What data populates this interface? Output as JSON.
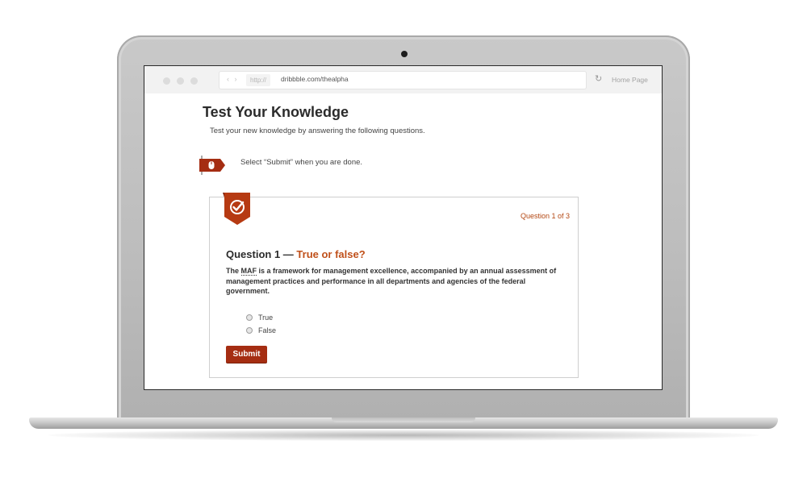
{
  "browser": {
    "protocol": "http://",
    "url": "dribbble.com/thealpha",
    "nav_arrows": "‹ ›",
    "refresh_icon": "refresh-icon",
    "home_link": "Home Page"
  },
  "page": {
    "title": "Test Your Knowledge",
    "subtitle": "Test your new knowledge by answering the following questions.",
    "instruction": "Select “Submit” when you are done.",
    "instruction_icon": "mouse-icon"
  },
  "quiz": {
    "badge_icon": "checkmark-badge-icon",
    "counter": "Question 1 of 3",
    "heading_prefix": "Question 1 — ",
    "heading_type": "True or false?",
    "text_prefix": "The ",
    "text_abbr": "MAF",
    "text_rest": " is a framework for management excellence, accompanied by an annual assessment of management practices and performance in all departments and agencies of the federal government.",
    "options": [
      {
        "label": "True"
      },
      {
        "label": "False"
      }
    ],
    "submit_label": "Submit"
  },
  "colors": {
    "accent": "#a52d12",
    "accent_text": "#c0501a",
    "badge": "#b63a12"
  }
}
